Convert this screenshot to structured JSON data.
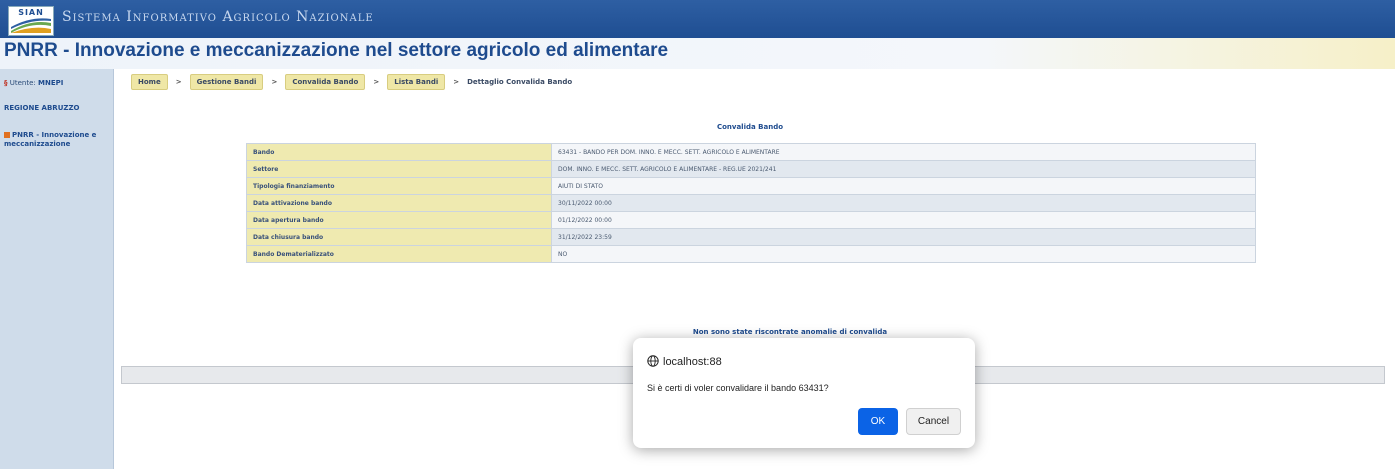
{
  "header": {
    "logo_text": "SIAN",
    "system_name": "Sistema Informativo Agricolo Nazionale"
  },
  "title": "PNRR - Innovazione e meccanizzazione nel settore agricolo ed alimentare",
  "sidebar": {
    "user_label": "Utente:",
    "user_value": "MNEPI",
    "region": "REGIONE ABRUZZO",
    "menu_item": "PNRR - Innovazione e meccanizzazione"
  },
  "breadcrumb": {
    "items": [
      "Home",
      "Gestione Bandi",
      "Convalida Bando",
      "Lista Bandi"
    ],
    "separator": ">",
    "current": "Dettaglio Convalida Bando"
  },
  "main": {
    "heading": "Convalida Bando",
    "rows": [
      {
        "label": "Bando",
        "value": "63431 - BANDO PER DOM. INNO. E MECC. SETT. AGRICOLO E ALIMENTARE"
      },
      {
        "label": "Settore",
        "value": "DOM. INNO. E MECC. SETT. AGRICOLO E ALIMENTARE - REG.UE 2021/241"
      },
      {
        "label": "Tipologia finanziamento",
        "value": "AIUTI DI STATO"
      },
      {
        "label": "Data attivazione bando",
        "value": "30/11/2022 00:00"
      },
      {
        "label": "Data apertura bando",
        "value": "01/12/2022 00:00"
      },
      {
        "label": "Data chiusura bando",
        "value": "31/12/2022 23:59"
      },
      {
        "label": "Bando Dematerializzato",
        "value": "NO"
      }
    ],
    "status_message": "Non sono state riscontrate anomalie di convalida"
  },
  "dialog": {
    "origin": "localhost:88",
    "message": "Si è certi di voler convalidare il bando 63431?",
    "ok_label": "OK",
    "cancel_label": "Cancel"
  },
  "colors": {
    "brand_blue": "#1e4b8e",
    "label_bg": "#efeab0",
    "ok_blue": "#0b63e6"
  }
}
